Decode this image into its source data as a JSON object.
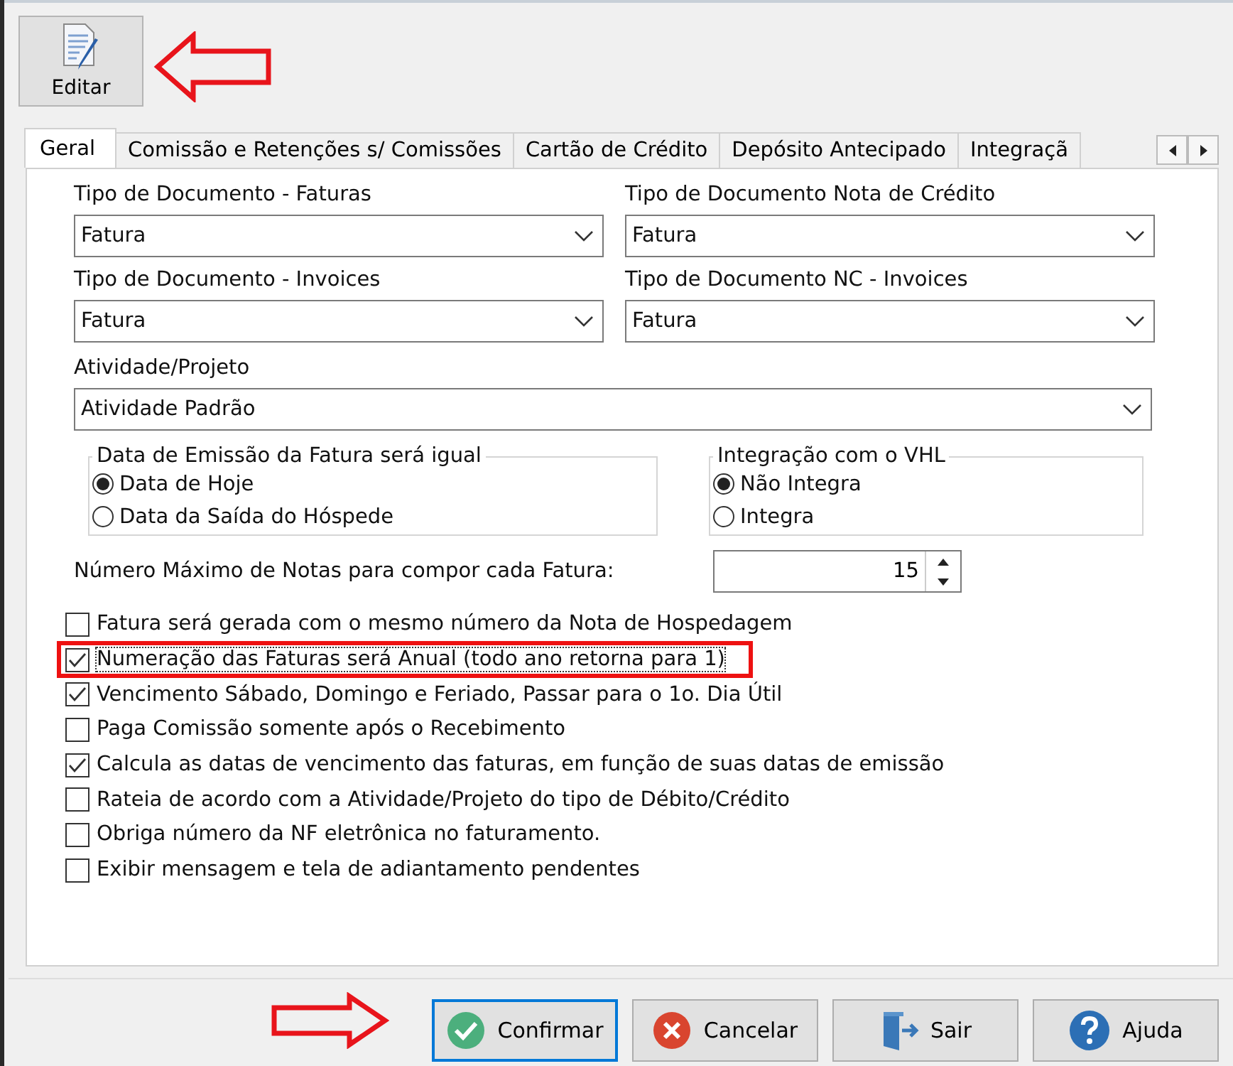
{
  "toolbar": {
    "buttons": [
      {
        "label": "Editar",
        "kind": "document-pencil"
      }
    ]
  },
  "tabs": [
    {
      "label": "Geral",
      "selected": true
    },
    {
      "label": "Comissão e Retenções s/ Comissões",
      "selected": false
    },
    {
      "label": "Cartão de Crédito",
      "selected": false
    },
    {
      "label": "Depósito Antecipado",
      "selected": false
    },
    {
      "label": "Integraçã",
      "selected": false
    }
  ],
  "dropdowns": [
    {
      "label": "Tipo de Documento - Faturas",
      "value": "Fatura"
    },
    {
      "label": "Tipo de Documento Nota de Crédito",
      "value": "Fatura"
    },
    {
      "label": "Tipo de Documento - Invoices",
      "value": "Fatura"
    },
    {
      "label": "Tipo de Documento NC - Invoices",
      "value": "Fatura"
    }
  ],
  "activity": {
    "label": "Atividade/Projeto",
    "value": "Atividade Padrão"
  },
  "radio_groups": [
    {
      "title": "Data de Emissão da Fatura será igual",
      "options": [
        {
          "label": "Data de Hoje",
          "selected": true
        },
        {
          "label": "Data da Saída do Hóspede",
          "selected": false
        }
      ]
    },
    {
      "title": "Integração com o VHL",
      "options": [
        {
          "label": "Não Integra",
          "selected": true
        },
        {
          "label": "Integra",
          "selected": false
        }
      ]
    }
  ],
  "max_notes": {
    "label": "Número Máximo de Notas para compor cada Fatura:",
    "value": "15"
  },
  "checkboxes": [
    {
      "label": "Fatura será gerada com o mesmo número da Nota de Hospedagem",
      "checked": false,
      "highlighted": false
    },
    {
      "label": "Numeração das Faturas será Anual (todo ano retorna para 1)",
      "checked": true,
      "highlighted": true
    },
    {
      "label": "Vencimento Sábado, Domingo e Feriado, Passar para o 1o. Dia Útil",
      "checked": true,
      "highlighted": false
    },
    {
      "label": "Paga Comissão somente após o Recebimento",
      "checked": false,
      "highlighted": false
    },
    {
      "label": "Calcula as datas de vencimento das faturas,  em função de suas datas de emissão",
      "checked": true,
      "highlighted": false
    },
    {
      "label": "Rateia de acordo com a Atividade/Projeto do tipo de Débito/Crédito",
      "checked": false,
      "highlighted": false
    },
    {
      "label": "Obriga número da NF eletrônica no faturamento.",
      "checked": false,
      "highlighted": false
    },
    {
      "label": "Exibir mensagem e tela de adiantamento pendentes",
      "checked": false,
      "highlighted": false
    }
  ],
  "buttons": [
    {
      "label": "Confirmar",
      "kind": "check",
      "focused": true
    },
    {
      "label": "Cancelar",
      "kind": "cancel",
      "focused": false
    },
    {
      "label": "Sair",
      "kind": "exit",
      "focused": false
    },
    {
      "label": "Ajuda",
      "kind": "help",
      "focused": false
    }
  ]
}
